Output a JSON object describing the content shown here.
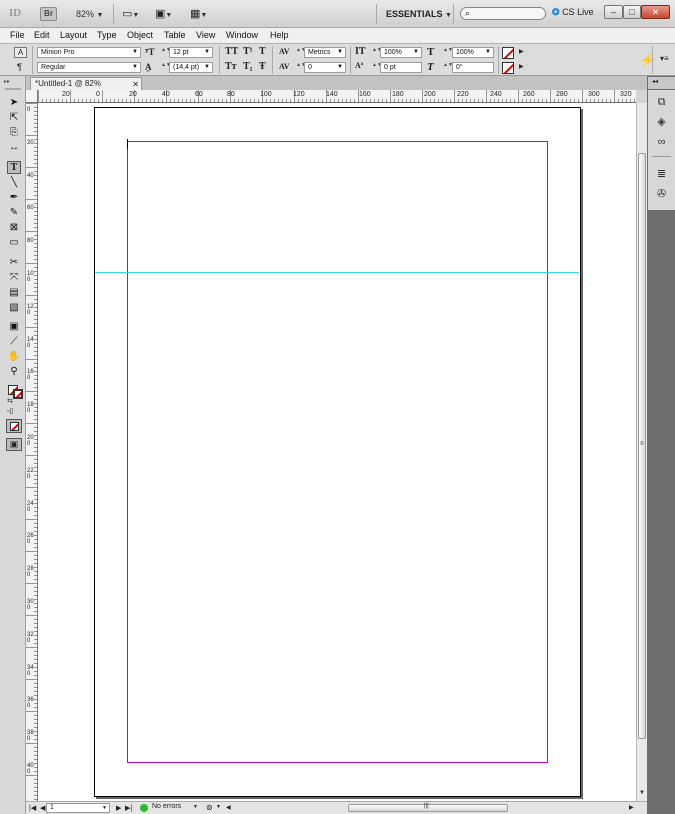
{
  "appbar": {
    "logo": "ID",
    "bridge": "Br",
    "zoom": "82%",
    "workspace": "ESSENTIALS",
    "cs_live": "CS Live",
    "window_buttons": [
      "–",
      "□",
      "✕"
    ]
  },
  "menu": [
    "File",
    "Edit",
    "Layout",
    "Type",
    "Object",
    "Table",
    "View",
    "Window",
    "Help"
  ],
  "control": {
    "font_family": "Minion Pro",
    "font_style": "Regular",
    "font_size": "12 pt",
    "leading": "(14,4 pt)",
    "kerning": "Metrics",
    "tracking": "0",
    "vertical_scale": "100%",
    "horizontal_scale": "100%",
    "baseline_shift": "0 pt",
    "skew": "0°"
  },
  "document": {
    "tab_title": "*Untitled-1 @ 82%",
    "close": "✕"
  },
  "ruler": {
    "h_labels": [
      "20",
      "0",
      "20",
      "40",
      "60",
      "80",
      "100",
      "120",
      "140",
      "160",
      "180",
      "200",
      "220",
      "240",
      "260",
      "280",
      "300",
      "320"
    ],
    "v_labels": [
      "0",
      "20",
      "40",
      "60",
      "80",
      "100",
      "120",
      "140",
      "160",
      "180",
      "200",
      "220",
      "240",
      "260",
      "280",
      "300",
      "320",
      "340",
      "360",
      "380",
      "400"
    ]
  },
  "status": {
    "page": "1",
    "preflight": "No errors"
  },
  "colors": {
    "margin": "#c400c4",
    "guide": "#35d6e0",
    "preflight_ok": "#2eb82e"
  }
}
